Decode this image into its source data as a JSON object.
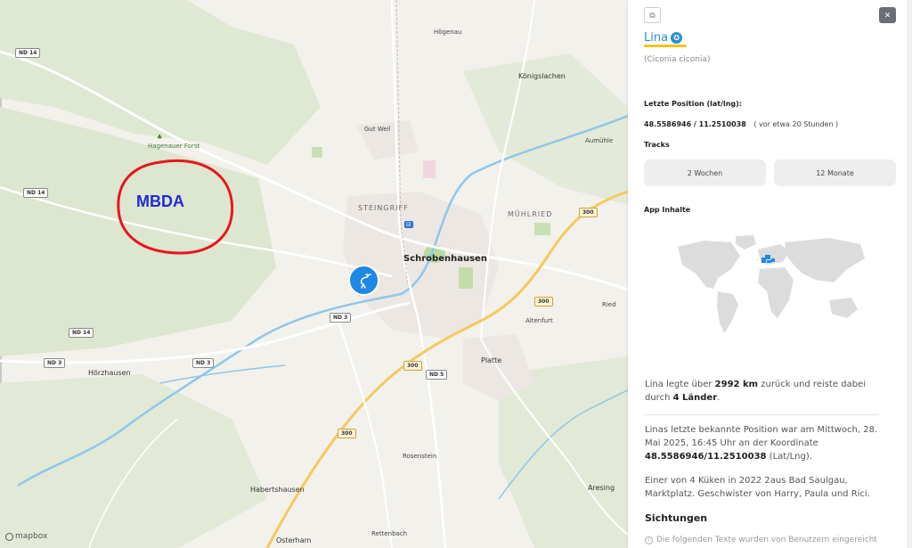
{
  "map": {
    "annotation": "MBDA",
    "labels": {
      "hoegenau": "Högenau",
      "koenigslachen": "Königslachen",
      "hagenauer_forst": "Hagenauer Forst",
      "gut_weil": "Gut Weil",
      "aumuehle": "Aumühle",
      "steingriff": "STEINGRIFF",
      "muehlried": "MÜHLRIED",
      "schrobenhausen": "Schrobenhausen",
      "ried": "Ried",
      "altenfurt": "Altenfurt",
      "hoerzhausen": "Hörzhausen",
      "platte": "Platte",
      "rosenstein": "Rosenstein",
      "arlesing": "Aresing",
      "habertshausen": "Habertshausen",
      "osterham": "Osterham",
      "rettenbach": "Rettenbach"
    },
    "road_shields": {
      "nd14_a": "ND 14",
      "nd14_b": "ND 14",
      "nd14_c": "ND 14",
      "nd3_a": "ND 3",
      "nd3_b": "ND 3",
      "nd3_c": "ND 3",
      "nd5": "ND 5",
      "b300_a": "300",
      "b300_b": "300",
      "b300_c": "300",
      "b300_d": "300"
    },
    "attribution": "mapbox",
    "marker_icon": "stork-icon"
  },
  "panel": {
    "name": "Lina",
    "latin": "(Ciconia ciconia)",
    "last_position_label": "Letzte Position (lat/lng):",
    "coords": "48.5586946 / 11.2510038",
    "time_ago": "( vor etwa 20 Stunden )",
    "tracks_label": "Tracks",
    "track_2w": "2 Wochen",
    "track_12m": "12 Monate",
    "app_label": "App Inhalte",
    "para1_a": "Lina legte über ",
    "para1_km": "2992 km",
    "para1_b": " zurück und reiste dabei durch ",
    "para1_countries": "4 Länder",
    "para1_c": ".",
    "para2_a": "Linas letzte bekannte Position war am Mittwoch, 28. Mai 2025, 16:45 Uhr an der Koordinate ",
    "para2_coord": "48.5586946/11.2510038",
    "para2_b": " (Lat/Lng).",
    "para3": "Einer von 4 Küken in 2022 2aus Bad Saulgau, Marktplatz. Geschwister von Harry, Paula und Rici.",
    "sightings": "Sichtungen",
    "note": "Die folgenden Texte wurden von Benutzern eingereicht",
    "accent": "#2a8fd6",
    "underline_color": "#f5c518",
    "highlight_color": "#1e88e5"
  }
}
